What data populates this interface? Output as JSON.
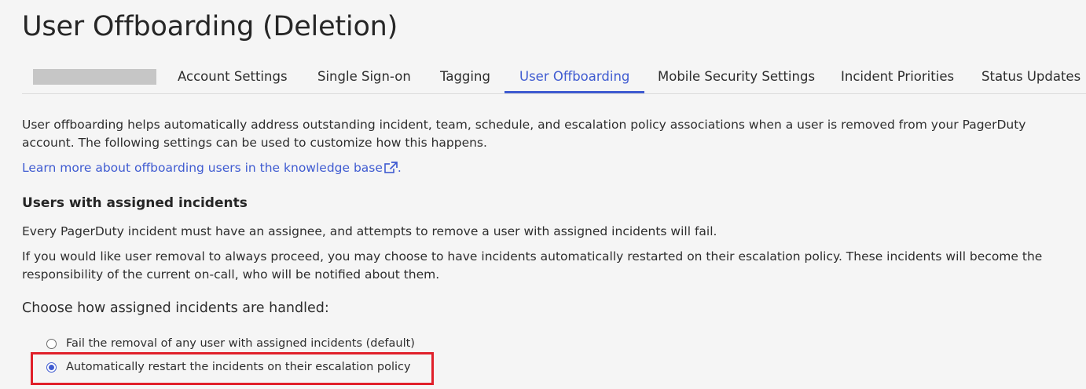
{
  "page": {
    "title": "User Offboarding (Deletion)"
  },
  "tabs": [
    {
      "label": "Account Settings",
      "active": false
    },
    {
      "label": "Single Sign-on",
      "active": false
    },
    {
      "label": "Tagging",
      "active": false
    },
    {
      "label": "User Offboarding",
      "active": true
    },
    {
      "label": "Mobile Security Settings",
      "active": false
    },
    {
      "label": "Incident Priorities",
      "active": false
    },
    {
      "label": "Status Updates",
      "active": false
    }
  ],
  "intro": {
    "text": "User offboarding helps automatically address outstanding incident, team, schedule, and escalation policy associations when a user is removed from your PagerDuty account. The following settings can be used to customize how this happens.",
    "link_text": "Learn more about offboarding users in the knowledge base",
    "link_suffix": ".",
    "link_icon": "external-link-icon"
  },
  "assigned_incidents": {
    "heading": "Users with assigned incidents",
    "para1": "Every PagerDuty incident must have an assignee, and attempts to remove a user with assigned incidents will fail.",
    "para2": "If you would like user removal to always proceed, you may choose to have incidents automatically restarted on their escalation policy. These incidents will become the responsibility of the current on-call, who will be notified about them.",
    "choose_label": "Choose how assigned incidents are handled:",
    "options": [
      {
        "label": "Fail the removal of any user with assigned incidents (default)",
        "selected": false
      },
      {
        "label": "Automatically restart the incidents on their escalation policy",
        "selected": true
      }
    ]
  },
  "colors": {
    "accent": "#3f5bd1",
    "highlight": "#e0202a",
    "background": "#f5f5f5"
  }
}
